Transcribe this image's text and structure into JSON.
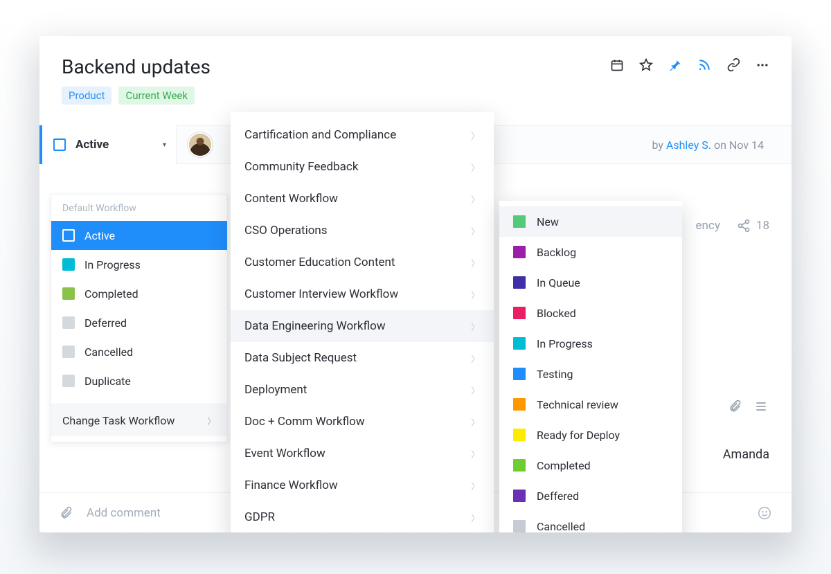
{
  "header": {
    "title": "Backend updates",
    "tags": {
      "product": "Product",
      "week": "Current Week"
    },
    "byline_prefix": "by ",
    "byline_author": "Ashley S.",
    "byline_date_prefix": " on ",
    "byline_date": "Nov 14"
  },
  "status_select": {
    "label": "Active"
  },
  "status_panel": {
    "heading": "Default Workflow",
    "states": [
      {
        "label": "Active",
        "color": "#1f8efa",
        "selected": true
      },
      {
        "label": "In Progress",
        "color": "#00bcd4",
        "selected": false
      },
      {
        "label": "Completed",
        "color": "#8bc34a",
        "selected": false
      },
      {
        "label": "Deferred",
        "color": "#d4d9de",
        "selected": false
      },
      {
        "label": "Cancelled",
        "color": "#d4d9de",
        "selected": false
      },
      {
        "label": "Duplicate",
        "color": "#d4d9de",
        "selected": false
      }
    ],
    "change_label": "Change Task Workflow"
  },
  "workflow_menu": {
    "items": [
      {
        "label": "Cartification and Compliance",
        "hover": false
      },
      {
        "label": "Community Feedback",
        "hover": false
      },
      {
        "label": "Content Workflow",
        "hover": false
      },
      {
        "label": "CSO Operations",
        "hover": false
      },
      {
        "label": "Customer Education Content",
        "hover": false
      },
      {
        "label": "Customer Interview Workflow",
        "hover": false
      },
      {
        "label": "Data Engineering Workflow",
        "hover": true
      },
      {
        "label": "Data Subject Request",
        "hover": false
      },
      {
        "label": "Deployment",
        "hover": false
      },
      {
        "label": "Doc + Comm Workflow",
        "hover": false
      },
      {
        "label": "Event Workflow",
        "hover": false
      },
      {
        "label": "Finance Workflow",
        "hover": false
      },
      {
        "label": "GDPR",
        "hover": false
      }
    ]
  },
  "status_flyout": {
    "items": [
      {
        "label": "New",
        "color": "#53c97a",
        "hover": true
      },
      {
        "label": "Backlog",
        "color": "#9b1fa8",
        "hover": false
      },
      {
        "label": "In Queue",
        "color": "#3f2ea8",
        "hover": false
      },
      {
        "label": "Blocked",
        "color": "#e91e63",
        "hover": false
      },
      {
        "label": "In Progress",
        "color": "#00bcd4",
        "hover": false
      },
      {
        "label": "Testing",
        "color": "#1f8efa",
        "hover": false
      },
      {
        "label": "Technical review",
        "color": "#ff9800",
        "hover": false
      },
      {
        "label": "Ready for Deploy",
        "color": "#ffeb00",
        "hover": false
      },
      {
        "label": "Completed",
        "color": "#6fce2f",
        "hover": false
      },
      {
        "label": "Deffered",
        "color": "#6b2fb5",
        "hover": false
      },
      {
        "label": "Cancelled",
        "color": "#c6ccd3",
        "hover": false
      }
    ]
  },
  "right_peek": {
    "word_fragment": "ency",
    "share_count": "18",
    "assignee": "Amanda"
  },
  "comment": {
    "placeholder": "Add comment"
  }
}
